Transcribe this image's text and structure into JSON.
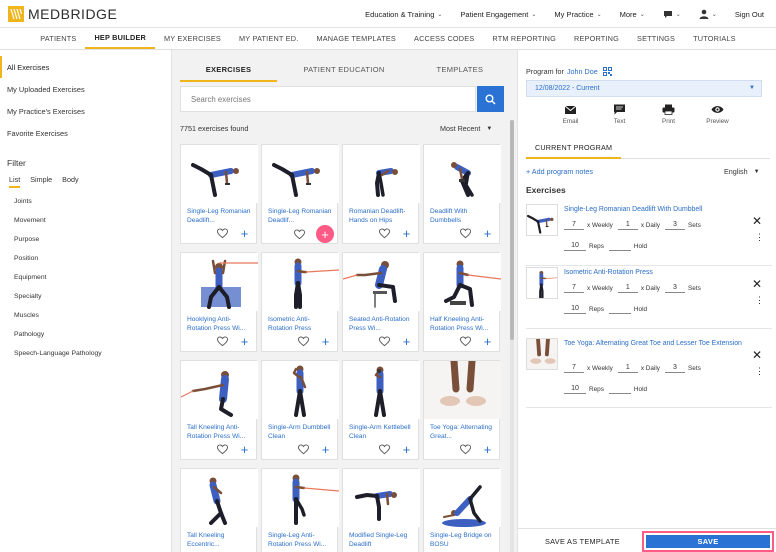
{
  "brand": {
    "name": "MEDBRIDGE",
    "color": "#f0b41c"
  },
  "topnav": {
    "items": [
      {
        "label": "Education & Training",
        "dropdown": true
      },
      {
        "label": "Patient Engagement",
        "dropdown": true
      },
      {
        "label": "My Practice",
        "dropdown": true
      },
      {
        "label": "More",
        "dropdown": true
      }
    ],
    "chat_icon": "chat-icon",
    "user_icon": "user-icon",
    "sign_out": "Sign Out"
  },
  "subnav": {
    "tabs": [
      {
        "label": "PATIENTS"
      },
      {
        "label": "HEP BUILDER",
        "active": true
      },
      {
        "label": "MY EXERCISES"
      },
      {
        "label": "MY PATIENT ED."
      },
      {
        "label": "MANAGE TEMPLATES"
      },
      {
        "label": "ACCESS CODES"
      },
      {
        "label": "RTM REPORTING"
      },
      {
        "label": "REPORTING"
      },
      {
        "label": "SETTINGS"
      },
      {
        "label": "TUTORIALS"
      }
    ]
  },
  "sidebar": {
    "items": [
      {
        "label": "All Exercises",
        "active": true
      },
      {
        "label": "My Uploaded Exercises"
      },
      {
        "label": "My Practice's Exercises"
      },
      {
        "label": "Favorite Exercises"
      }
    ],
    "filter": {
      "title": "Filter",
      "tabs": [
        {
          "label": "List",
          "active": true
        },
        {
          "label": "Simple"
        },
        {
          "label": "Body"
        }
      ],
      "items": [
        {
          "label": "Joints"
        },
        {
          "label": "Movement"
        },
        {
          "label": "Purpose"
        },
        {
          "label": "Position"
        },
        {
          "label": "Equipment"
        },
        {
          "label": "Specialty"
        },
        {
          "label": "Muscles"
        },
        {
          "label": "Pathology"
        },
        {
          "label": "Speech-Language Pathology"
        }
      ]
    }
  },
  "center": {
    "tabs": [
      {
        "label": "EXERCISES",
        "active": true
      },
      {
        "label": "PATIENT EDUCATION"
      },
      {
        "label": "TEMPLATES"
      }
    ],
    "search": {
      "placeholder": "Search exercises"
    },
    "found": "7751 exercises found",
    "sort": "Most Recent",
    "cards": [
      {
        "title": "Single-Leg Romanian Deadlift...",
        "pose": "rdl"
      },
      {
        "title": "Single-Leg Romanian Deadlif...",
        "pose": "rdl"
      },
      {
        "title": "Romanian Deadlift- Hands on Hips",
        "pose": "hinge"
      },
      {
        "title": "Deadlift With Dumbbells",
        "pose": "deadlift"
      },
      {
        "title": "Hooklying Anti-Rotation Press Wi...",
        "pose": "hooklying"
      },
      {
        "title": "Isometric Anti-Rotation Press",
        "pose": "standband"
      },
      {
        "title": "Seated Anti-Rotation Press Wi...",
        "pose": "seated"
      },
      {
        "title": "Half Kneeling Anti-Rotation Press Wi...",
        "pose": "halfkneel"
      },
      {
        "title": "Tall Kneeling Anti-Rotation Press Wi...",
        "pose": "tallkneel"
      },
      {
        "title": "Single-Arm Dumbbell Clean",
        "pose": "stand"
      },
      {
        "title": "Single-Arm Kettlebell Clean",
        "pose": "stand2"
      },
      {
        "title": "Toe Yoga: Alternating Great...",
        "pose": "feet"
      },
      {
        "title": "Tall Kneeling Eccentric...",
        "pose": "kneelback"
      },
      {
        "title": "Single-Leg Anti-Rotation Press Wi...",
        "pose": "standband2"
      },
      {
        "title": "Modified Single-Leg Deadlift",
        "pose": "hinge2"
      },
      {
        "title": "Single-Leg Bridge on BOSU",
        "pose": "bridge"
      }
    ]
  },
  "program": {
    "label": "Program for",
    "patient": "John Doe",
    "date": "12/08/2022 - Current",
    "actions": [
      {
        "label": "Email",
        "icon": "email-icon"
      },
      {
        "label": "Text",
        "icon": "text-icon"
      },
      {
        "label": "Print",
        "icon": "print-icon"
      },
      {
        "label": "Preview",
        "icon": "preview-icon"
      }
    ],
    "current_tab": "CURRENT PROGRAM",
    "add_notes": "+ Add program notes",
    "language": "English",
    "exercises_heading": "Exercises",
    "weekly_label": "x Weekly",
    "daily_label": "x Daily",
    "sets_label": "Sets",
    "reps_label": "Reps",
    "hold_label": "Hold",
    "exercises": [
      {
        "title": "Single-Leg Romanian Deadlift With Dumbbell",
        "weekly": "7",
        "daily": "1",
        "sets": "3",
        "reps": "10",
        "pose": "rdl"
      },
      {
        "title": "Isometric Anti-Rotation Press",
        "weekly": "7",
        "daily": "1",
        "sets": "3",
        "reps": "10",
        "pose": "standband"
      },
      {
        "title": "Toe Yoga: Alternating Great Toe and Lesser Toe Extension",
        "weekly": "7",
        "daily": "1",
        "sets": "3",
        "reps": "10",
        "pose": "feet"
      }
    ],
    "save_template": "SAVE AS TEMPLATE",
    "save": "SAVE"
  },
  "colors": {
    "accent": "#2a73d4",
    "link": "#2a6ec9",
    "highlight": "#ff5b86",
    "tab_underline": "#f0b41c"
  }
}
